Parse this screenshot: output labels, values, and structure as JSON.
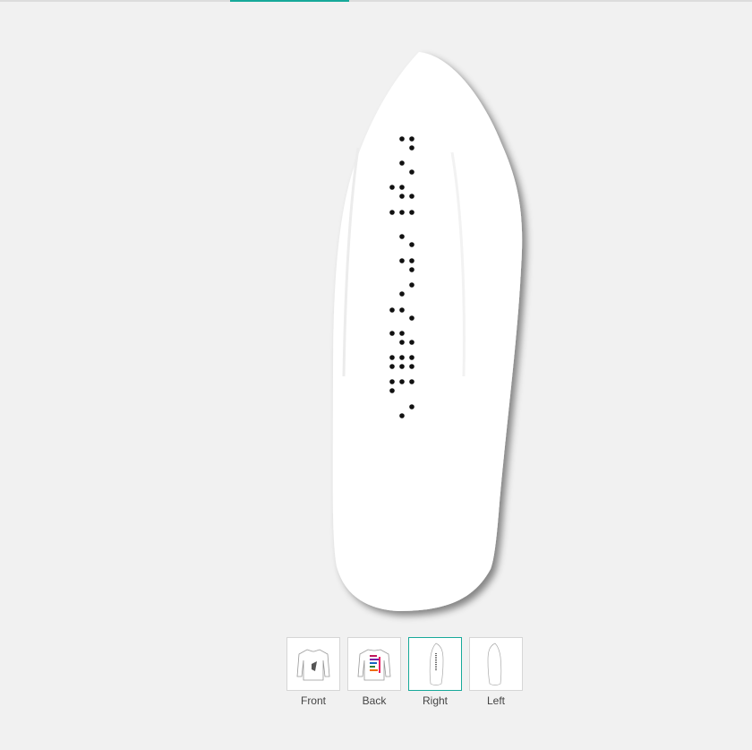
{
  "view": {
    "current_view": "Right",
    "accent_color": "#17a99a",
    "design": "braille-dots-sleeve-print"
  },
  "thumbnails": [
    {
      "label": "Front",
      "selected": false,
      "icon": "shirt-front-icon"
    },
    {
      "label": "Back",
      "selected": false,
      "icon": "shirt-back-icon"
    },
    {
      "label": "Right",
      "selected": true,
      "icon": "shirt-right-icon"
    },
    {
      "label": "Left",
      "selected": false,
      "icon": "shirt-left-icon"
    }
  ]
}
